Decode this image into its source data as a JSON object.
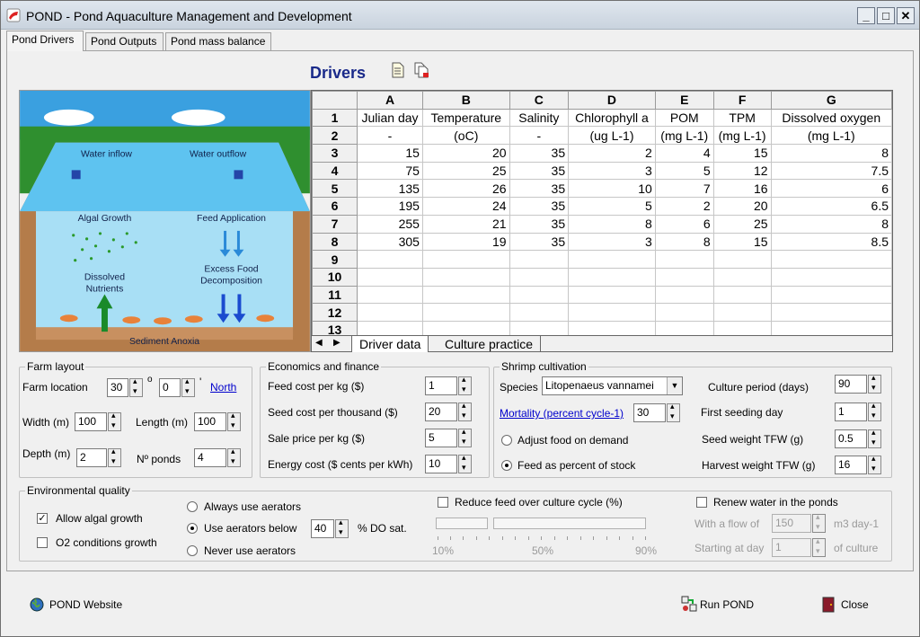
{
  "window": {
    "title": "POND - Pond Aquaculture Management and Development"
  },
  "tabs": [
    "Pond Drivers",
    "Pond Outputs",
    "Pond mass balance"
  ],
  "drivers_title": "Drivers",
  "diagram": {
    "labels": {
      "water_inflow": "Water inflow",
      "water_outflow": "Water outflow",
      "algal_growth": "Algal Growth",
      "feed_application": "Feed Application",
      "dissolved_nutrients_1": "Dissolved",
      "dissolved_nutrients_2": "Nutrients",
      "excess_food_1": "Excess Food",
      "excess_food_2": "Decomposition",
      "sediment": "Sediment Anoxia"
    }
  },
  "sheet": {
    "columns": [
      "A",
      "B",
      "C",
      "D",
      "E",
      "F",
      "G"
    ],
    "row_numbers": [
      "1",
      "2",
      "3",
      "4",
      "5",
      "6",
      "7",
      "8",
      "9",
      "10",
      "11",
      "12",
      "13"
    ],
    "header_row": [
      "Julian day",
      "Temperature",
      "Salinity",
      "Chlorophyll a",
      "POM",
      "TPM",
      "Dissolved oxygen"
    ],
    "units_row": [
      "-",
      "(oC)",
      "-",
      "(ug L-1)",
      "(mg L-1)",
      "(mg L-1)",
      "(mg L-1)"
    ],
    "rows": [
      [
        "15",
        "20",
        "35",
        "2",
        "4",
        "15",
        "8"
      ],
      [
        "75",
        "25",
        "35",
        "3",
        "5",
        "12",
        "7.5"
      ],
      [
        "135",
        "26",
        "35",
        "10",
        "7",
        "16",
        "6"
      ],
      [
        "195",
        "24",
        "35",
        "5",
        "2",
        "20",
        "6.5"
      ],
      [
        "255",
        "21",
        "35",
        "8",
        "6",
        "25",
        "8"
      ],
      [
        "305",
        "19",
        "35",
        "3",
        "8",
        "15",
        "8.5"
      ]
    ],
    "tabs": [
      "Driver data",
      "Culture practice"
    ]
  },
  "farm_layout": {
    "legend": "Farm layout",
    "location_label": "Farm location",
    "location_deg": "30",
    "deg_symbol": "o",
    "location_min": "0",
    "min_symbol": "'",
    "hemisphere": "North",
    "width_label": "Width (m)",
    "width": "100",
    "length_label": "Length (m)",
    "length": "100",
    "depth_label": "Depth (m)",
    "depth": "2",
    "ponds_label": "Nº ponds",
    "ponds": "4"
  },
  "economics": {
    "legend": "Economics and finance",
    "feed_cost_label": "Feed cost per kg ($)",
    "feed_cost": "1",
    "seed_cost_label": "Seed cost per thousand ($)",
    "seed_cost": "20",
    "sale_price_label": "Sale price per kg ($)",
    "sale_price": "5",
    "energy_cost_label": "Energy cost ($ cents per kWh)",
    "energy_cost": "10"
  },
  "shrimp": {
    "legend": "Shrimp cultivation",
    "species_label": "Species",
    "species": "Litopenaeus vannamei",
    "mortality_label": "Mortality (percent cycle-1)",
    "mortality": "30",
    "adjust_food": "Adjust food on demand",
    "feed_percent": "Feed as percent of stock",
    "culture_period_label": "Culture period (days)",
    "culture_period": "90",
    "first_seeding_label": "First seeding day",
    "first_seeding": "1",
    "seed_weight_label": "Seed weight TFW (g)",
    "seed_weight": "0.5",
    "harvest_weight_label": "Harvest weight TFW (g)",
    "harvest_weight": "16"
  },
  "environment": {
    "legend": "Environmental quality",
    "allow_algal": "Allow algal growth",
    "o2_conditions": "O2 conditions growth",
    "always_aerators": "Always use aerators",
    "aerators_below": "Use aerators below",
    "aerators_value": "40",
    "do_sat": "% DO sat.",
    "never_aerators": "Never use aerators",
    "reduce_feed": "Reduce feed over culture cycle (%)",
    "slider_min": "10%",
    "slider_mid": "50%",
    "slider_max": "90%",
    "renew_water": "Renew water in the ponds",
    "flow_label": "With a flow of",
    "flow_value": "150",
    "flow_unit": "m3 day-1",
    "starting_label": "Starting at day",
    "starting_value": "1",
    "starting_unit": "of culture"
  },
  "bottom": {
    "website": "POND Website",
    "run": "Run POND",
    "close": "Close"
  },
  "colors": {
    "title_blue": "#1a2a8a",
    "link": "#0000cc",
    "sky": "#3a9fdf",
    "water": "#5cc0ee",
    "grass": "#2e8f2e",
    "soil": "#b07a48"
  }
}
